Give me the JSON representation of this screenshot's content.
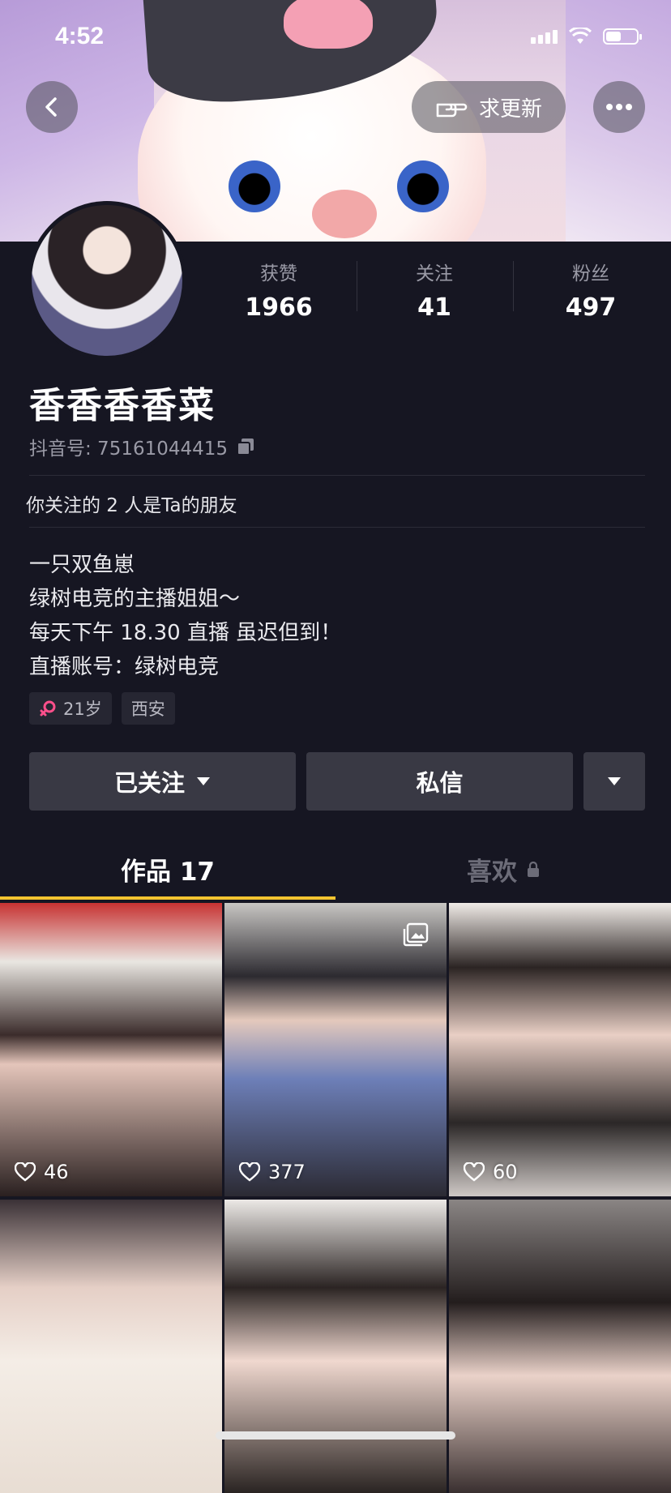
{
  "status_bar": {
    "time": "4:52"
  },
  "header": {
    "request_update_label": "求更新",
    "back_icon": "chevron-left-icon",
    "more_icon": "ellipsis-icon"
  },
  "profile": {
    "name": "香香香香菜",
    "douyin_id_label": "抖音号: 75161044415",
    "stats": [
      {
        "label": "获赞",
        "value": "1966"
      },
      {
        "label": "关注",
        "value": "41"
      },
      {
        "label": "粉丝",
        "value": "497"
      }
    ],
    "friends_text": "你关注的 2 人是Ta的朋友",
    "bio_lines": [
      "一只双鱼崽",
      "绿树电竞的主播姐姐～",
      "每天下午 18.30 直播 虽迟但到！",
      "直播账号：绿树电竞"
    ],
    "tags": {
      "age": "21岁",
      "location": "西安"
    }
  },
  "actions": {
    "followed_label": "已关注",
    "message_label": "私信"
  },
  "tabs": {
    "works_label": "作品 17",
    "likes_label": "喜欢"
  },
  "grid": [
    {
      "likes": "46"
    },
    {
      "likes": "377"
    },
    {
      "likes": "60"
    },
    {
      "likes": ""
    },
    {
      "likes": ""
    },
    {
      "likes": ""
    }
  ],
  "colors": {
    "background": "#161622",
    "accent_tab": "#f4c430",
    "female_icon": "#ff4f8b"
  }
}
